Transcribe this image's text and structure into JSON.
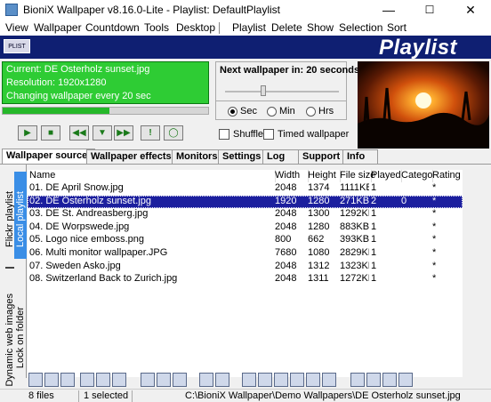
{
  "window": {
    "title": "BioniX Wallpaper v8.16.0-Lite - Playlist: DefaultPlaylist",
    "minimize": "—",
    "maximize": "☐",
    "close": "✕"
  },
  "menu": [
    "View",
    "Wallpaper",
    "Countdown",
    "Tools",
    "Desktop",
    "Playlist",
    "Delete",
    "Show",
    "Selection",
    "Sort"
  ],
  "banner": {
    "logo_text": "PLIST",
    "title": "Playlist"
  },
  "info": {
    "current": "Current: DE Osterholz sunset.jpg",
    "resolution": "Resolution:  1920x1280",
    "changing": "Changing wallpaper every 20 sec"
  },
  "progress": {
    "fraction": 0.52
  },
  "next": {
    "label": "Next wallpaper in: 20 seconds",
    "slider_fraction": 0.33
  },
  "units": {
    "sec": "Sec",
    "min": "Min",
    "hrs": "Hrs",
    "selected": "Sec"
  },
  "options": {
    "shuffle": "Shuffle",
    "timed": "Timed wallpaper"
  },
  "controls": [
    "play-icon",
    "stop-icon",
    "rewind-icon",
    "down-icon",
    "forward-icon",
    "exclamation-icon",
    "circle-icon"
  ],
  "tabs": [
    "Wallpaper source",
    "Wallpaper effects",
    "Monitors",
    "Settings",
    "Log",
    "Support",
    "Info"
  ],
  "side_tabs": {
    "flickr": "Flickr playlist",
    "local": "Local playlist",
    "dynamic": "Dynamic web images",
    "lock": "Lock on folder"
  },
  "columns": [
    "Name",
    "Width",
    "Height",
    "File size",
    "Played",
    "Categor",
    "Rating"
  ],
  "rows": [
    [
      "01. DE April Snow.jpg",
      "2048",
      "1374",
      "1111KB",
      "1",
      "",
      "*"
    ],
    [
      "02. DE Osterholz sunset.jpg",
      "1920",
      "1280",
      "271KB",
      "2",
      "0",
      "*"
    ],
    [
      "03. DE St. Andreasberg.jpg",
      "2048",
      "1300",
      "1292KB",
      "1",
      "",
      "*"
    ],
    [
      "04. DE Worpswede.jpg",
      "2048",
      "1280",
      "883KB",
      "1",
      "",
      "*"
    ],
    [
      "05. Logo nice emboss.png",
      "800",
      "662",
      "393KB",
      "1",
      "",
      "*"
    ],
    [
      "06. Multi monitor wallpaper.JPG",
      "7680",
      "1080",
      "2829KB",
      "1",
      "",
      "*"
    ],
    [
      "07. Sweden Asko.jpg",
      "2048",
      "1312",
      "1323KB",
      "1",
      "",
      "*"
    ],
    [
      "08. Switzerland Back to Zurich.jpg",
      "2048",
      "1311",
      "1272KB",
      "1",
      "",
      "*"
    ]
  ],
  "selected_row": 1,
  "colors": {
    "banner": "#0f1f72",
    "info_green": "#2ecc34",
    "selection": "#1c1f9e"
  },
  "status": {
    "files": "8 files",
    "selected": "1 selected",
    "path": "C:\\BioniX Wallpaper\\Demo Wallpapers\\DE Osterholz sunset.jpg"
  }
}
